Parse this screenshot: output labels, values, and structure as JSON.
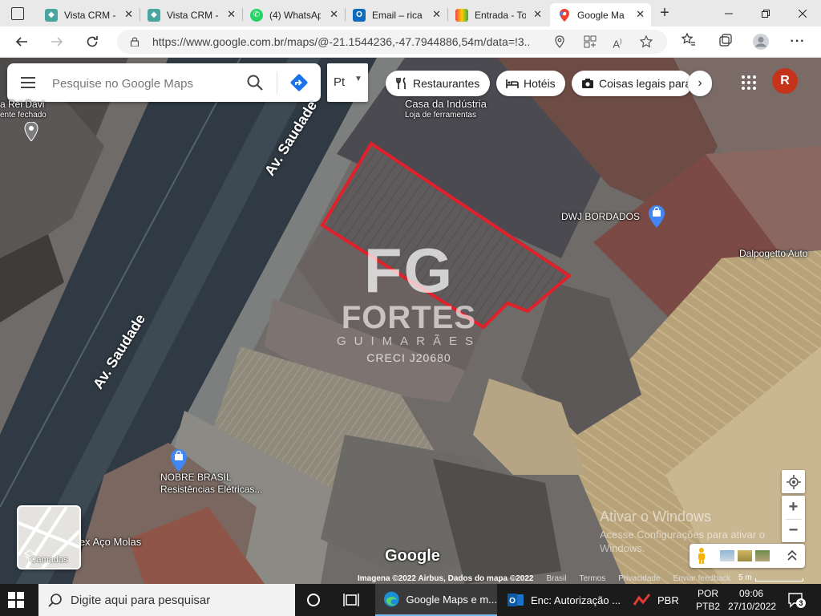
{
  "browser": {
    "tabs": [
      {
        "title": "Vista CRM -",
        "icon": "vista-crm-icon"
      },
      {
        "title": "Vista CRM -",
        "icon": "vista-crm-icon"
      },
      {
        "title": "(4) WhatsAp",
        "icon": "whatsapp-icon"
      },
      {
        "title": "Email – rica",
        "icon": "outlook-icon"
      },
      {
        "title": "Entrada - To",
        "icon": "mail-icon"
      },
      {
        "title": "Google Ma",
        "icon": "google-maps-icon"
      }
    ],
    "close_glyph": "✕",
    "new_tab_glyph": "+",
    "url": "https://www.google.com.br/maps/@-21.1544236,-47.7944886,54m/data=!3..."
  },
  "maps": {
    "search_placeholder": "Pesquise no Google Maps",
    "language_label": "Pt",
    "chips": [
      {
        "label": "Restaurantes",
        "icon": "restaurant-icon"
      },
      {
        "label": "Hotéis",
        "icon": "hotel-icon"
      },
      {
        "label": "Coisas legais para",
        "icon": "camera-icon"
      }
    ],
    "avatar_letter": "R",
    "places": {
      "casa_industria": "Casa da Indústria",
      "casa_industria_sub": "Loja de ferramentas",
      "rei_davi": "a Rei Davi",
      "rei_davi_sub": "ente fechado",
      "dwj": "DWJ BORDADOS",
      "dalpogetto": "Dalpogetto Auto",
      "nobre": "NOBRE BRASIL",
      "nobre_sub": "Resistências Elétricas...",
      "aco_molas": "lex Aço Molas"
    },
    "roads": [
      "Av. Saudade",
      "Av. Saudade"
    ],
    "watermark": {
      "logo": "FG",
      "name": "FORTES",
      "sub": "GUIMARÃES",
      "creci": "CRECI J20680"
    },
    "activate_title": "Ativar o Windows",
    "activate_text": "Acesse Configurações para ativar o",
    "activate_text2": "Windows.",
    "layers_label": "Camadas",
    "google_logo": "Google",
    "attribution": {
      "imagery": "Imagena ©2022 Airbus, Dados do mapa ©2022",
      "links": [
        "Brasil",
        "Termos",
        "Privacidade",
        "Enviar feedback"
      ],
      "scale": "5 m"
    },
    "zoom_in": "+",
    "zoom_out": "−"
  },
  "taskbar": {
    "search_placeholder": "Digite aqui para pesquisar",
    "items": [
      {
        "label": "Google Maps e m...",
        "icon": "edge-icon"
      },
      {
        "label": "Enc: Autorização ...",
        "icon": "outlook-icon"
      },
      {
        "label": "PBR",
        "icon": "stock-chart-icon"
      }
    ],
    "lang": "POR",
    "lang2": "PTB2",
    "time": "09:06",
    "date": "27/10/2022",
    "notifications": "3"
  }
}
